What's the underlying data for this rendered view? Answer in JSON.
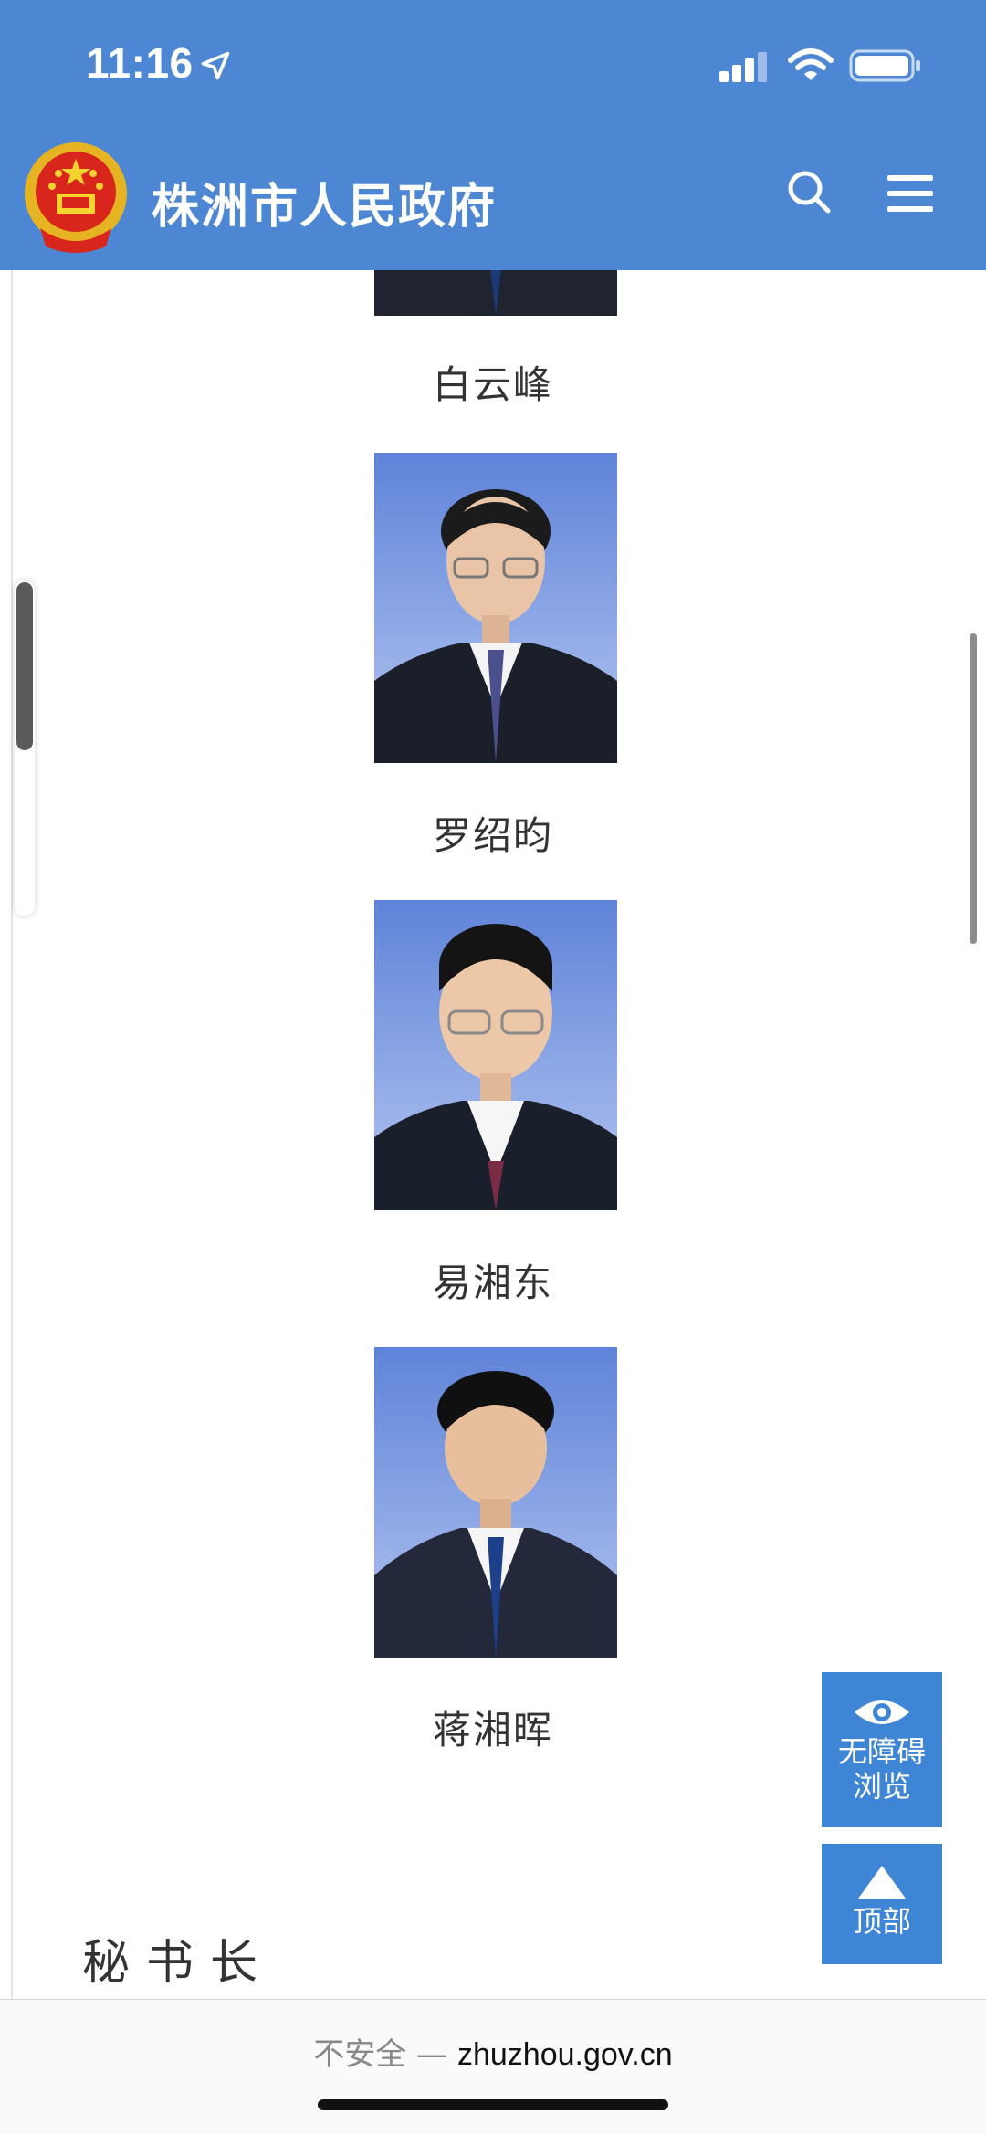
{
  "status_bar": {
    "time": "11:16"
  },
  "header": {
    "title": "株洲市人民政府"
  },
  "officials": [
    {
      "name": "白云峰"
    },
    {
      "name": "罗绍昀"
    },
    {
      "name": "易湘东"
    },
    {
      "name": "蒋湘晖"
    }
  ],
  "section": {
    "title": "秘书长"
  },
  "floating_buttons": {
    "accessibility_line1": "无障碍",
    "accessibility_line2": "浏览",
    "top": "顶部"
  },
  "browser": {
    "insecure_label": "不安全 —",
    "host": "zhuzhou.gov.cn"
  },
  "colors": {
    "header_bg": "#4d87d3",
    "fab_bg": "#3f85d6"
  },
  "icons": [
    "location-arrow-icon",
    "signal-icon",
    "wifi-icon",
    "battery-icon",
    "emblem-logo",
    "search-icon",
    "menu-icon",
    "eye-icon",
    "arrow-up-icon"
  ]
}
